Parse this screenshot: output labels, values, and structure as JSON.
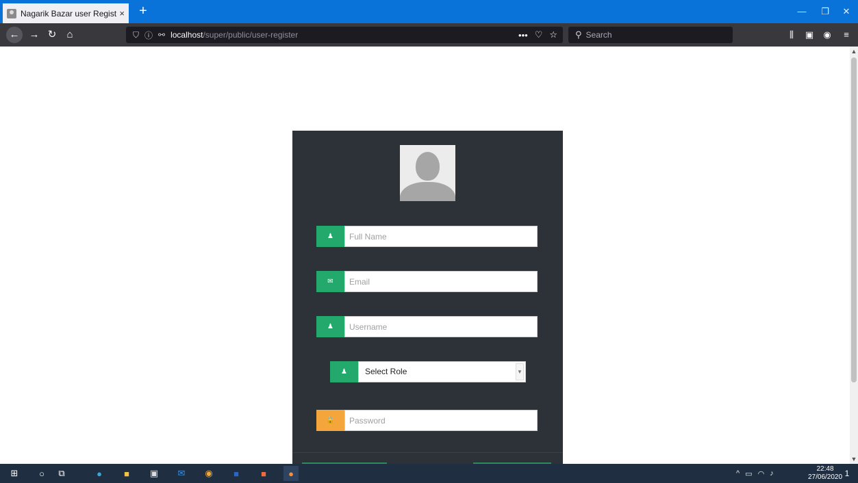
{
  "browser": {
    "tab_title": "Nagarik Bazar user Registration",
    "tab_close": "×",
    "new_tab": "+",
    "url_host": "localhost",
    "url_path": "/super/public/user-register",
    "page_actions": "•••",
    "search_placeholder": "Search",
    "window_controls": {
      "minimize": "—",
      "restore": "❐",
      "close": "✕"
    },
    "icons": [
      "back-icon",
      "forward-icon",
      "reload-icon",
      "home-icon",
      "shield-icon",
      "info-icon",
      "permissions-icon",
      "pocket-icon",
      "bookmark-star-icon",
      "library-icon",
      "sidebar-icon",
      "account-icon",
      "menu-icon"
    ]
  },
  "form": {
    "full_name_placeholder": "Full Name",
    "email_placeholder": "Email",
    "username_placeholder": "Username",
    "role_selected": "Select Role",
    "password_placeholder": "Password"
  },
  "colors": {
    "card_bg": "#2c3238",
    "icon_green": "#23a96b",
    "icon_orange": "#f4a63c",
    "titlebar_blue": "#0a73d9"
  },
  "taskbar": {
    "time": "22:48",
    "date": "27/06/2020",
    "notification_count": "1",
    "icons": [
      "windows-start-icon",
      "search-icon",
      "task-view-icon",
      "edge-icon",
      "file-explorer-icon",
      "store-icon",
      "mail-icon",
      "chrome-icon",
      "word-icon",
      "xampp-icon",
      "firefox-icon"
    ]
  }
}
